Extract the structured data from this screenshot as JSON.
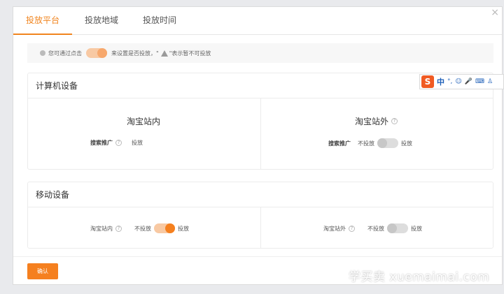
{
  "tabs": [
    {
      "label": "投放平台",
      "active": true
    },
    {
      "label": "投放地域",
      "active": false
    },
    {
      "label": "投放时间",
      "active": false
    }
  ],
  "close_glyph": "×",
  "hint": {
    "before": "您可通过点击",
    "middle": "来设置是否投放，\"",
    "after": "\"表示暂不可投放"
  },
  "computer": {
    "title": "计算机设备",
    "inside": {
      "title": "淘宝站内",
      "row_label": "搜索推广",
      "value": "投放"
    },
    "outside": {
      "title": "淘宝站外",
      "row_label": "搜索推广",
      "off_label": "不投放",
      "on_label": "投放",
      "toggle_on": false
    }
  },
  "mobile": {
    "title": "移动设备",
    "inside": {
      "row_label": "淘宝站内",
      "off_label": "不投放",
      "on_label": "投放",
      "toggle_on": true
    },
    "outside": {
      "row_label": "淘宝站外",
      "off_label": "不投放",
      "on_label": "投放",
      "toggle_on": false
    }
  },
  "confirm_label": "确认",
  "ime": {
    "logo": "S",
    "lang": "中",
    "punct": "°,",
    "emoji": "☺",
    "mic": "🎤",
    "kbd": "⌨",
    "user": "♙"
  },
  "watermark": "学买卖 xuemaimai.com",
  "colors": {
    "accent": "#f5801f",
    "tab_active": "#f0841e"
  }
}
